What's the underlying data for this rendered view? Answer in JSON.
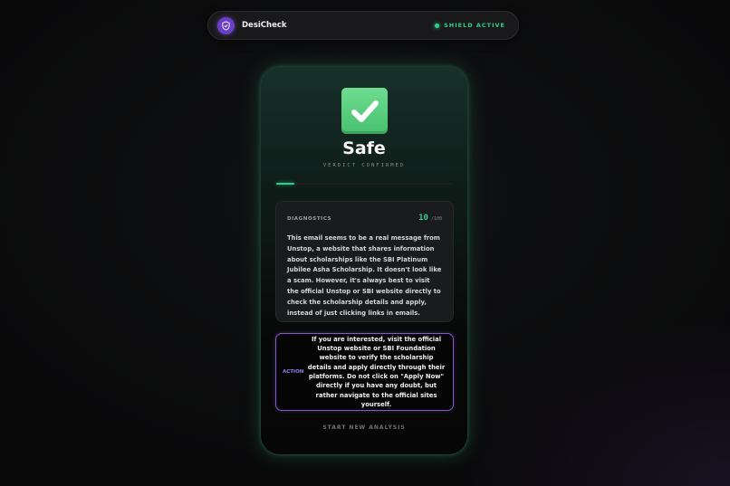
{
  "colors": {
    "accent_green": "#2fcf8f",
    "accent_purple": "#8754d4",
    "verdict_green": "#5fd384",
    "brand_purple": "#6a3fc8"
  },
  "header": {
    "brand_icon": "shield-icon",
    "brand_name": "DesiCheck",
    "status_icon": "status-dot-icon",
    "status_text": "SHIELD ACTIVE"
  },
  "verdict": {
    "icon": "checkmark-icon",
    "title": "Safe",
    "subtitle": "VERDICT CONFIRMED",
    "risk_fraction": 0.1
  },
  "diagnostics": {
    "label": "DIAGNOSTICS",
    "score": "10",
    "max": "/100",
    "text": "This email seems to be a real message from Unstop, a website that shares information about scholarships like the SBI Platinum Jubilee Asha Scholarship. It doesn't look like a scam. However, it's always best to visit the official Unstop or SBI website directly to check the scholarship details and apply, instead of just clicking links in emails."
  },
  "action": {
    "label": "ACTION",
    "text": "If you are interested, visit the official Unstop website or SBI Foundation website to verify the scholarship details and apply directly through their platforms. Do not click on \"Apply Now\" directly if you have any doubt, but rather navigate to the official sites yourself."
  },
  "footer": {
    "new_analysis_label": "START NEW ANALYSIS"
  }
}
